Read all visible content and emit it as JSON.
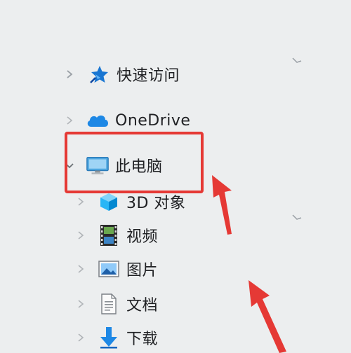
{
  "nav": {
    "items": [
      {
        "label": "快速访问",
        "icon": "star-pin-icon",
        "expanded": false
      },
      {
        "label": "OneDrive",
        "icon": "cloud-icon",
        "expanded": false
      },
      {
        "label": "此电脑",
        "icon": "monitor-icon",
        "expanded": true
      },
      {
        "label": "3D 对象",
        "icon": "cube-3d-icon",
        "expanded": false
      },
      {
        "label": "视频",
        "icon": "film-icon",
        "expanded": false
      },
      {
        "label": "图片",
        "icon": "picture-icon",
        "expanded": false
      },
      {
        "label": "文档",
        "icon": "document-icon",
        "expanded": false
      },
      {
        "label": "下载",
        "icon": "download-arrow-icon",
        "expanded": false
      }
    ]
  },
  "colors": {
    "background": "#eceeef",
    "annotation_red": "#e53935",
    "cloud_blue": "#1e88e5",
    "star_blue": "#1976d2",
    "download_blue": "#1e88e5"
  }
}
